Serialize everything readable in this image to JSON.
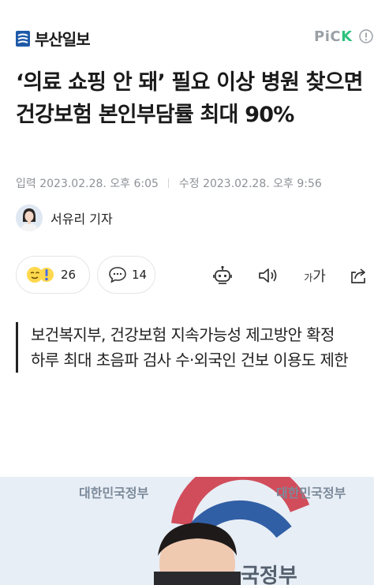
{
  "header": {
    "logo_text": "부산일보",
    "pick_prefix": "PiC",
    "pick_suffix": "K",
    "brand_color": "#1e5aa8",
    "pick_color": "#2ec27e"
  },
  "article": {
    "headline": "‘의료 쇼핑 안 돼’ 필요 이상 병원 찾으면 건강보험 본인부담률 최대 90%",
    "input_label": "입력",
    "input_time": "2023.02.28. 오후 6:05",
    "edit_label": "수정",
    "edit_time": "2023.02.28. 오후 9:56",
    "reporter": "서유리 기자"
  },
  "actions": {
    "reaction_count": "26",
    "comment_count": "14",
    "font_size_label_small": "가",
    "font_size_label_large": "가"
  },
  "summary": {
    "lines": [
      "보건복지부, 건강보험 지속가능성 제고방안 확정",
      "하루 최대 초음파 검사 수·외국인 건보 이용도 제한"
    ]
  },
  "photo": {
    "backdrop_text_left": "대한민국정부",
    "backdrop_text_right": "대한민국정부",
    "backdrop_text_center": "국정부"
  }
}
